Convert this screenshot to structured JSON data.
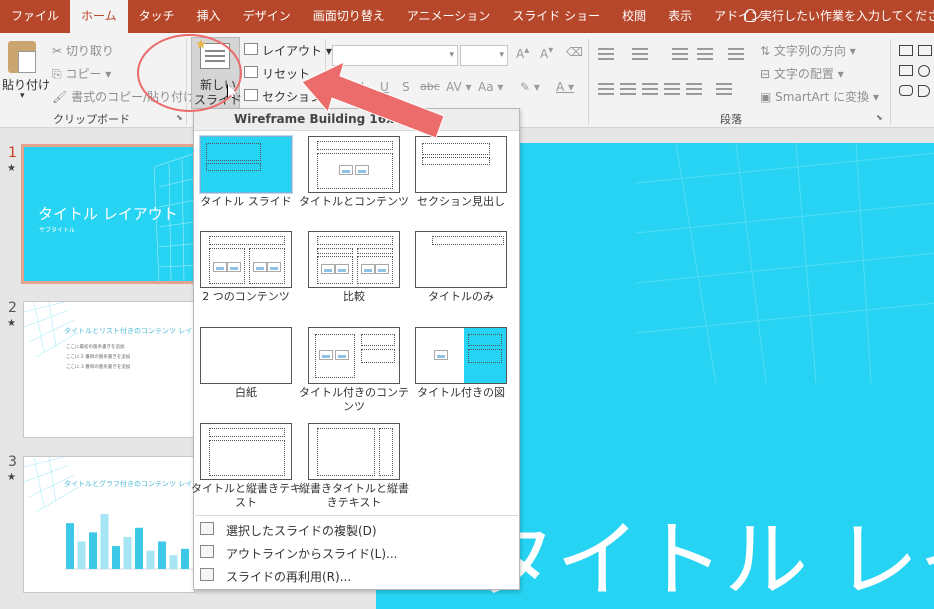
{
  "tabs": [
    {
      "label": "ファイル",
      "active": false
    },
    {
      "label": "ホーム",
      "active": true
    },
    {
      "label": "タッチ",
      "active": false
    },
    {
      "label": "挿入",
      "active": false
    },
    {
      "label": "デザイン",
      "active": false
    },
    {
      "label": "画面切り替え",
      "active": false
    },
    {
      "label": "アニメーション",
      "active": false
    },
    {
      "label": "スライド ショー",
      "active": false
    },
    {
      "label": "校閲",
      "active": false
    },
    {
      "label": "表示",
      "active": false
    },
    {
      "label": "アドイン",
      "active": false
    }
  ],
  "tell_me": "実行したい作業を入力してください",
  "clipboard": {
    "paste": "貼り付け",
    "cut": "切り取り",
    "copy": "コピー",
    "format_painter": "書式のコピー/貼り付け",
    "group_label": "クリップボード"
  },
  "slides_group": {
    "new_slide_line1": "新しい",
    "new_slide_line2": "スライド",
    "layout": "レイアウト",
    "reset": "リセット",
    "section": "セクション"
  },
  "font_group": {
    "bold": "B",
    "italic": "I",
    "underline": "U",
    "shadow": "S",
    "strike": "abc",
    "spacing": "AV",
    "case": "Aa"
  },
  "paragraph_group": {
    "text_direction": "文字列の方向",
    "align_text": "文字の配置",
    "smartart": "SmartArt に変換",
    "group_label": "段落"
  },
  "dropdown": {
    "header": "Wireframe Building 16x9",
    "layouts": [
      {
        "label": "タイトル スライド"
      },
      {
        "label": "タイトルとコンテンツ"
      },
      {
        "label": "セクション見出し"
      },
      {
        "label": "2 つのコンテンツ"
      },
      {
        "label": "比較"
      },
      {
        "label": "タイトルのみ"
      },
      {
        "label": "白紙"
      },
      {
        "label": "タイトル付きのコンテンツ"
      },
      {
        "label": "タイトル付きの図"
      },
      {
        "label": "タイトルと縦書きテキスト"
      },
      {
        "label": "縦書きタイトルと縦書きテキスト"
      }
    ],
    "menu": [
      {
        "label": "選択したスライドの複製(D)"
      },
      {
        "label": "アウトラインからスライド(L)..."
      },
      {
        "label": "スライドの再利用(R)..."
      }
    ]
  },
  "thumbnails": [
    {
      "number": "1",
      "star": "★",
      "title": "タイトル レイアウト",
      "subtitle": "サブタイトル"
    },
    {
      "number": "2",
      "star": "★",
      "title": "タイトルとリスト付きのコンテンツ レイアウト",
      "bullets": [
        "ここに最初の箇条書きを追加",
        "ここに 2 番目の箇条書きを追加",
        "ここに 3 番目の箇条書きを追加"
      ]
    },
    {
      "number": "3",
      "star": "★",
      "title": "タイトルとグラフ付きのコンテンツ レイアウト",
      "bar_values": [
        5.0,
        3.0,
        4.0,
        6.0,
        2.5,
        3.5,
        4.5,
        2.0,
        3.0,
        1.5,
        2.2
      ]
    }
  ],
  "main_slide": {
    "title": "タイトル レイアウト"
  },
  "colors": {
    "brand": "#b7472a",
    "slide_bg": "#26d3f2",
    "annotation": "#ec6b6b"
  }
}
